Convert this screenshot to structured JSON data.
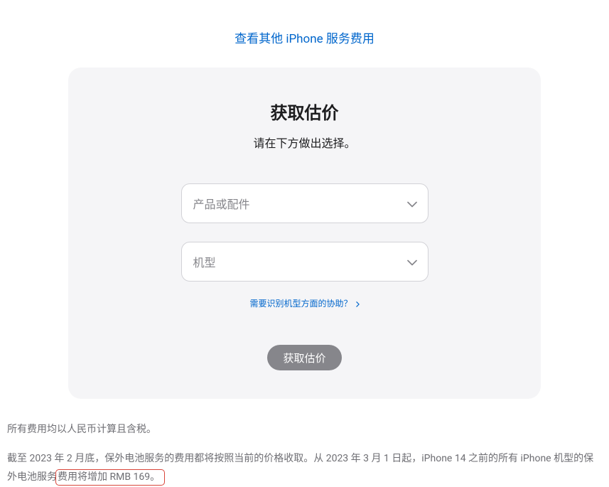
{
  "topLink": {
    "label": "查看其他 iPhone 服务费用"
  },
  "card": {
    "title": "获取估价",
    "subtitle": "请在下方做出选择。",
    "select1": {
      "placeholder": "产品或配件"
    },
    "select2": {
      "placeholder": "机型"
    },
    "helpLink": {
      "label": "需要识别机型方面的协助？"
    },
    "button": {
      "label": "获取估价"
    }
  },
  "footer": {
    "p1": "所有费用均以人民币计算且含税。",
    "p2_part1": "截至 2023 年 2 月底，保外电池服务的费用都将按照当前的价格收取。从 2023 年 3 月 1 日起，iPhone 14 之前的所有 iPhone 机型的保外电池服务",
    "p2_highlight": "费用将增加 RMB 169。"
  }
}
